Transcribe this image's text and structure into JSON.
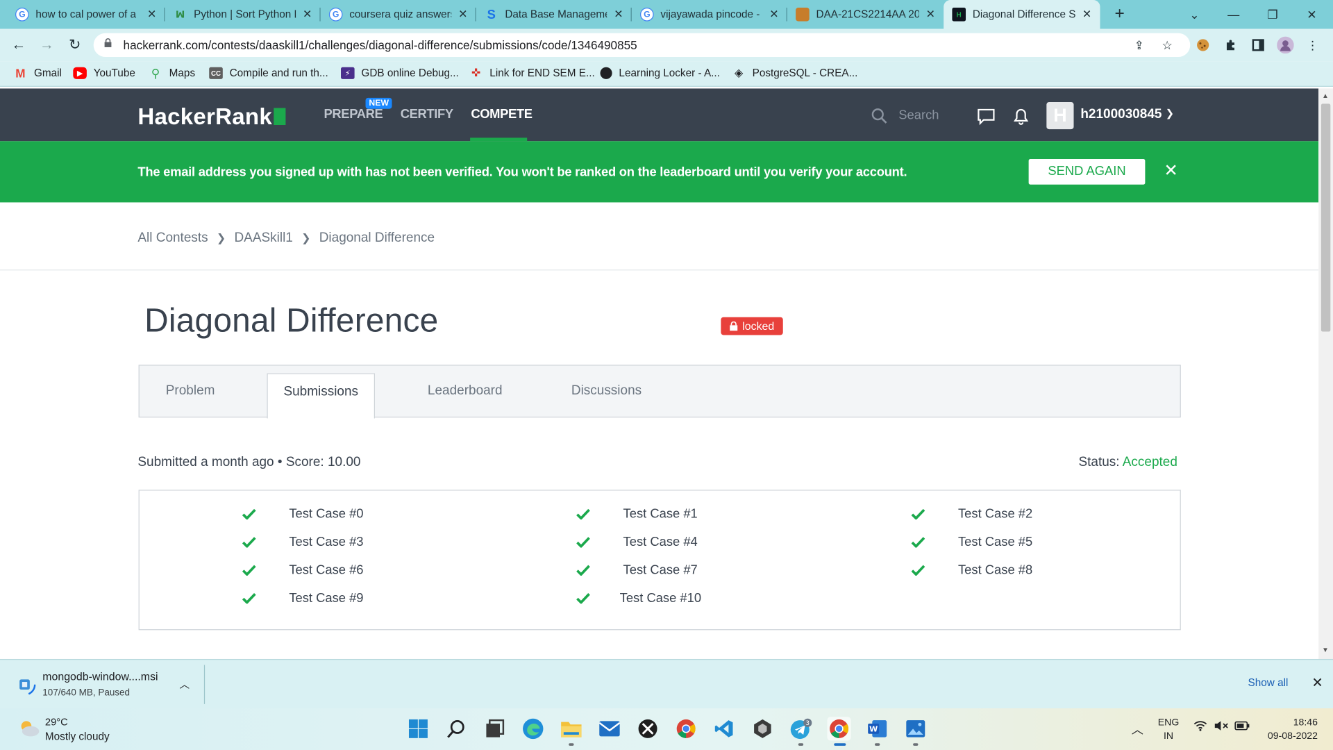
{
  "browser": {
    "tabs": [
      {
        "title": "how to cal power of a",
        "fav": "google-icon",
        "color": "#4285f4"
      },
      {
        "title": "Python | Sort Python D",
        "fav": "gfg-icon",
        "color": "#2f8d46"
      },
      {
        "title": "coursera quiz answers",
        "fav": "google-icon",
        "color": "#4285f4"
      },
      {
        "title": "Data Base Manageme",
        "fav": "s-icon",
        "color": "#1a73e8"
      },
      {
        "title": "vijayawada pincode -",
        "fav": "google-icon",
        "color": "#4285f4"
      },
      {
        "title": "DAA-21CS2214AA 20",
        "fav": "lms-icon",
        "color": "#c77d2b"
      },
      {
        "title": "Diagonal Difference S",
        "fav": "hackerrank-icon",
        "color": "#0e141e"
      }
    ],
    "new_tab": "+",
    "url": "hackerrank.com/contests/daaskill1/challenges/diagonal-difference/submissions/code/1346490855",
    "bookmarks": [
      {
        "label": "Gmail",
        "icon": "gmail-icon"
      },
      {
        "label": "YouTube",
        "icon": "youtube-icon"
      },
      {
        "label": "Maps",
        "icon": "maps-icon"
      },
      {
        "label": "Compile and run th...",
        "icon": "cc-icon"
      },
      {
        "label": "GDB online Debug...",
        "icon": "gdb-icon"
      },
      {
        "label": "Link for END SEM E...",
        "icon": "link-icon"
      },
      {
        "label": "Learning Locker - A...",
        "icon": "learning-locker-icon"
      },
      {
        "label": "PostgreSQL - CREA...",
        "icon": "postgres-icon"
      }
    ]
  },
  "header": {
    "logo": "HackerRank",
    "nav": {
      "prepare": "PREPARE",
      "new_badge": "NEW",
      "certify": "CERTIFY",
      "compete": "COMPETE"
    },
    "search_placeholder": "Search",
    "avatar_letter": "H",
    "username": "h2100030845"
  },
  "banner": {
    "message": "The email address you signed up with has not been verified. You won't be ranked on the leaderboard until you verify your account.",
    "send_again": "SEND AGAIN"
  },
  "breadcrumb": [
    "All Contests",
    "DAASkill1",
    "Diagonal Difference"
  ],
  "challenge": {
    "title": "Diagonal Difference",
    "locked_label": "locked",
    "tabs": [
      "Problem",
      "Submissions",
      "Leaderboard",
      "Discussions"
    ],
    "active_tab": "Submissions",
    "submitted": "Submitted a month ago",
    "score_label": "Score: 10.00",
    "status_label": "Status:",
    "status_value": "Accepted",
    "test_cases": [
      "Test Case #0",
      "Test Case #1",
      "Test Case #2",
      "Test Case #3",
      "Test Case #4",
      "Test Case #5",
      "Test Case #6",
      "Test Case #7",
      "Test Case #8",
      "Test Case #9",
      "Test Case #10"
    ]
  },
  "downloads": {
    "file": "mongodb-window....msi",
    "progress": "107/640 MB, Paused",
    "show_all": "Show all"
  },
  "taskbar": {
    "temp": "29°C",
    "weather": "Mostly cloudy",
    "lang_line1": "ENG",
    "lang_line2": "IN",
    "time": "18:46",
    "date": "09-08-2022",
    "telegram_badge": "3"
  },
  "colors": {
    "accent_green": "#1ba94c",
    "nav_bg": "#39424e",
    "locked_red": "#e8403b"
  }
}
